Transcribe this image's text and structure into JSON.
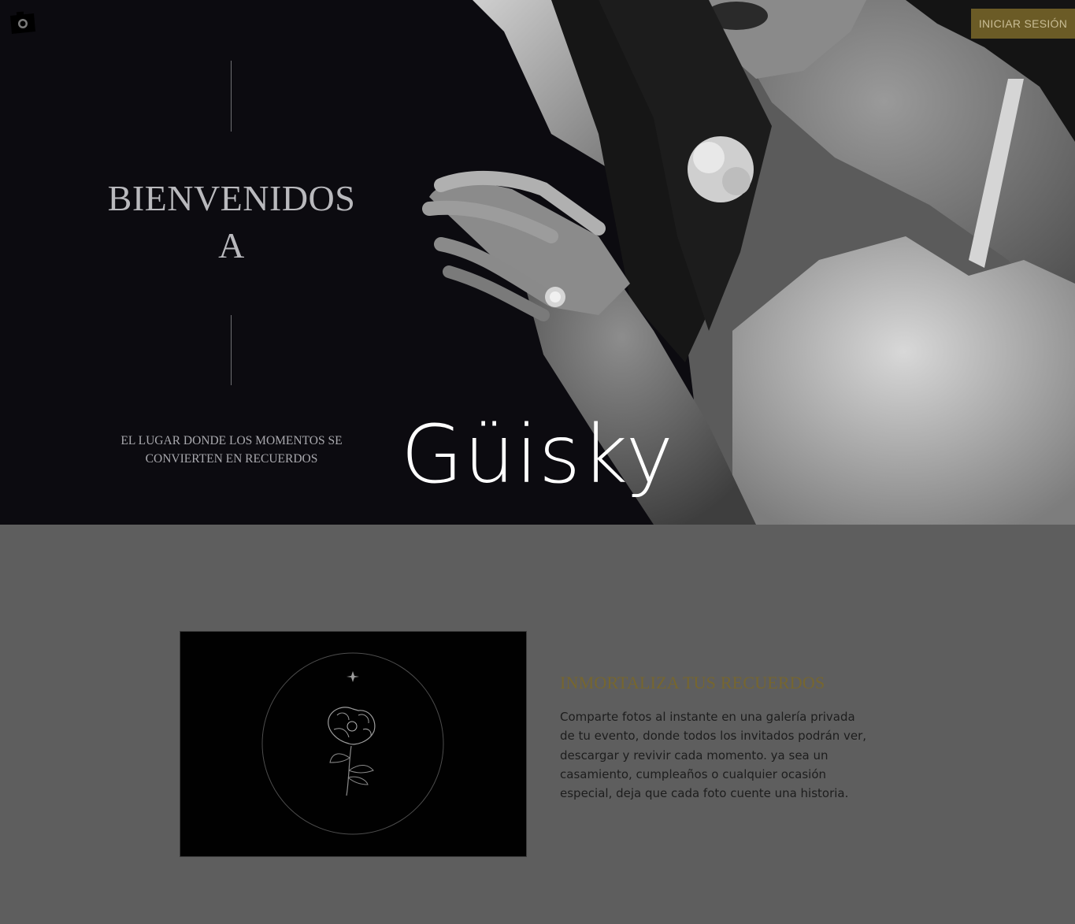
{
  "header": {
    "logo_icon": "camera-icon",
    "login_label": "INICIAR SESIÓN"
  },
  "hero": {
    "title_line1": "BIENVENIDOS",
    "title_line2": "A",
    "subtitle_line1": "EL LUGAR DONDE LOS MOMENTOS SE",
    "subtitle_line2": "CONVIERTEN EN RECUERDOS"
  },
  "brand": {
    "name": "Güisky"
  },
  "feature": {
    "card_icon": "flower-icon",
    "heading": "INMORTALIZA TUS RECUERDOS",
    "text": "Comparte fotos al instante en una galería privada de tu evento, donde todos los invitados podrán ver, descargar y revivir cada momento. ya sea un casamiento, cumpleaños o cualquier ocasión especial, deja que cada foto cuente una historia."
  },
  "colors": {
    "accent_gold": "#6b5b26",
    "heading_gold": "#76662f",
    "section_bg": "#5e5e5e",
    "hero_bg": "#0c0b10"
  }
}
